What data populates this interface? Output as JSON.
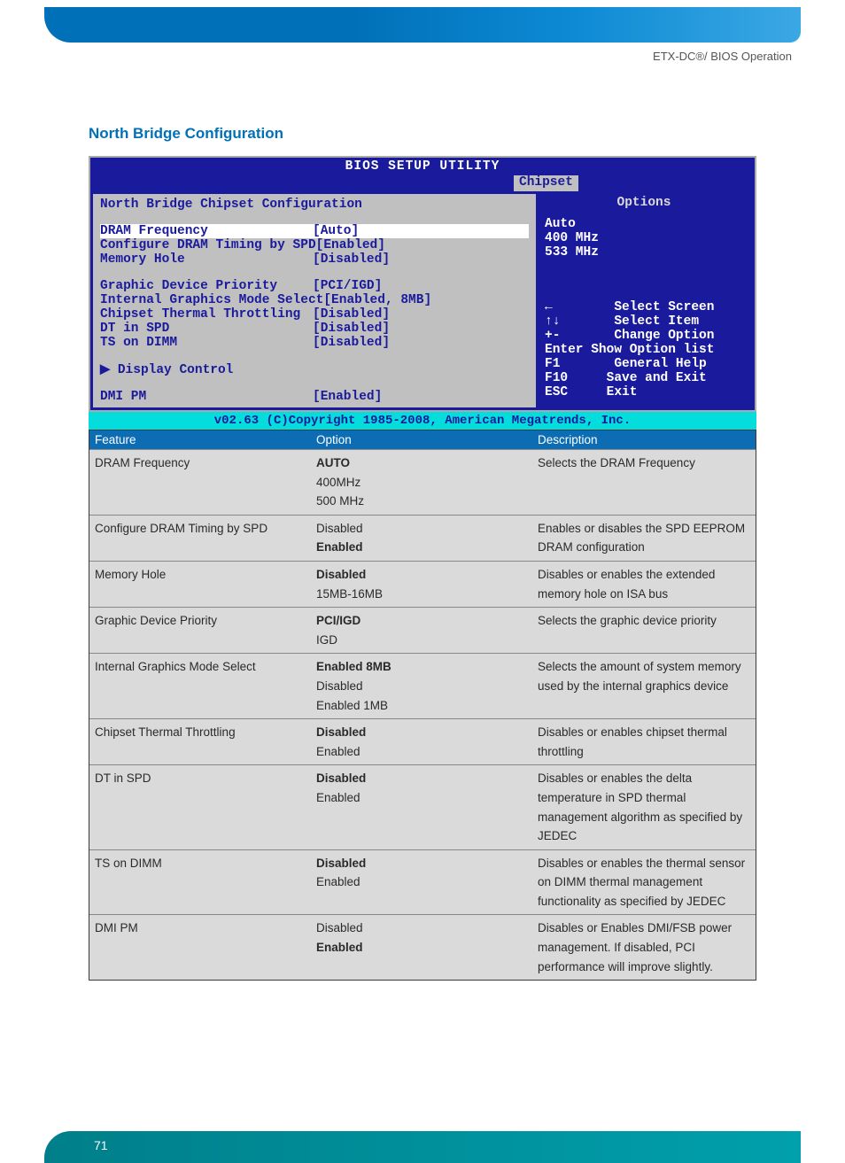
{
  "header": {
    "breadcrumb": "ETX-DC®/ BIOS Operation"
  },
  "section": {
    "title": "North Bridge Configuration"
  },
  "bios": {
    "title": "BIOS SETUP UTILITY",
    "tab": "Chipset",
    "heading": "North Bridge Chipset Configuration",
    "rows_group1": [
      {
        "label": "DRAM Frequency",
        "value": "[Auto]",
        "highlight": true
      },
      {
        "label": "Configure DRAM Timing by SPD",
        "value": "[Enabled]",
        "highlight": false
      },
      {
        "label": "Memory Hole",
        "value": "[Disabled]",
        "highlight": false
      }
    ],
    "rows_group2": [
      {
        "label": "Graphic Device Priority",
        "value": "[PCI/IGD]"
      },
      {
        "label": "Internal Graphics Mode Select",
        "value": "[Enabled, 8MB]"
      },
      {
        "label": "Chipset Thermal Throttling",
        "value": "[Disabled]"
      },
      {
        "label": "DT in SPD",
        "value": "[Disabled]"
      },
      {
        "label": "TS on DIMM",
        "value": "[Disabled]"
      }
    ],
    "submenu": "▶ Display Control",
    "rows_group3": [
      {
        "label": "DMI PM",
        "value": "[Enabled]"
      }
    ],
    "options_title": "Options",
    "options": [
      "Auto",
      "400 MHz",
      "533 MHz"
    ],
    "nav": [
      {
        "key": "←",
        "desc": "   Select Screen"
      },
      {
        "key": "↑↓",
        "desc": "   Select Item"
      },
      {
        "key": "+-",
        "desc": "   Change Option"
      },
      {
        "key": "Enter",
        "desc": "Show Option list"
      },
      {
        "key": "F1",
        "desc": "   General Help"
      },
      {
        "key": "F10",
        "desc": "  Save and Exit"
      },
      {
        "key": "ESC",
        "desc": "  Exit"
      }
    ],
    "footer": "v02.63 (C)Copyright 1985-2008, American Megatrends, Inc."
  },
  "table": {
    "headers": {
      "feature": "Feature",
      "option": "Option",
      "description": "Description"
    },
    "rows": [
      {
        "feature": "DRAM Frequency",
        "options": [
          {
            "t": "AUTO",
            "b": true
          },
          {
            "t": "400MHz"
          },
          {
            "t": "500 MHz"
          }
        ],
        "desc": "Selects the DRAM Frequency"
      },
      {
        "feature": "Configure DRAM Timing by SPD",
        "options": [
          {
            "t": "Disabled"
          },
          {
            "t": "Enabled",
            "b": true
          }
        ],
        "desc": "Enables or disables the SPD EEPROM DRAM configuration"
      },
      {
        "feature": "Memory Hole",
        "options": [
          {
            "t": "Disabled",
            "b": true
          },
          {
            "t": "15MB-16MB"
          }
        ],
        "desc": "Disables or enables the extended memory hole on ISA bus"
      },
      {
        "feature": "Graphic Device Priority",
        "options": [
          {
            "t": "PCI/IGD",
            "b": true
          },
          {
            "t": "IGD"
          }
        ],
        "desc": "Selects the graphic device priority"
      },
      {
        "feature": "Internal Graphics Mode Select",
        "options": [
          {
            "t": "Enabled 8MB",
            "b": true
          },
          {
            "t": "Disabled"
          },
          {
            "t": "Enabled 1MB"
          }
        ],
        "desc": "Selects the amount of system memory used by the internal graphics device"
      },
      {
        "feature": "Chipset Thermal Throttling",
        "options": [
          {
            "t": "Disabled",
            "b": true
          },
          {
            "t": "Enabled"
          }
        ],
        "desc": "Disables or enables chipset thermal throttling"
      },
      {
        "feature": "DT in SPD",
        "options": [
          {
            "t": "Disabled",
            "b": true
          },
          {
            "t": "Enabled"
          }
        ],
        "desc": "Disables or enables the delta temperature in SPD thermal management algorithm as specified by JEDEC"
      },
      {
        "feature": "TS on DIMM",
        "options": [
          {
            "t": "Disabled",
            "b": true
          },
          {
            "t": "Enabled"
          }
        ],
        "desc": "Disables or enables the thermal sensor on DIMM thermal management functionality as specified by JEDEC"
      },
      {
        "feature": "DMI PM",
        "options": [
          {
            "t": "Disabled"
          },
          {
            "t": "Enabled",
            "b": true
          }
        ],
        "desc": "Disables or Enables DMI/FSB power management. If disabled, PCI performance will improve slightly."
      }
    ]
  },
  "footer": {
    "page": "71"
  }
}
